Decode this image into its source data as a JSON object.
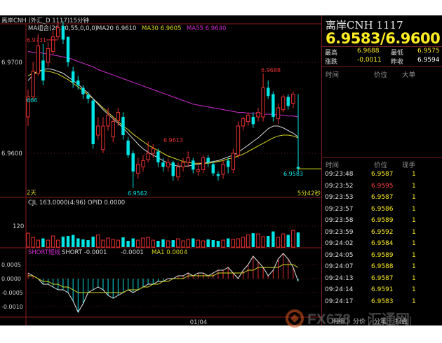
{
  "colors": {
    "up": "#00e5e5",
    "down": "#e83030",
    "ma20": "#d8d8d8",
    "ma30": "#d9d920",
    "ma55": "#d02cd0",
    "price_yellow": "#ffee22"
  },
  "chart": {
    "header": "离岸CNH (外汇_D 1117)15分钟",
    "ma_label": "MA组合(20,30,55,0,0,0)",
    "ma20": "MA20 6.9610",
    "ma30": "MA30 6.9605",
    "ma55": "MA55 6.9640",
    "y_labels": [
      "6.9700",
      "6.9600"
    ],
    "annotations": {
      "high_left": "6.9731",
      "left_666": "666",
      "a_6_9688": "6.9688",
      "a_6_9613": "6.9613",
      "a_6_9562": "6.9562",
      "a_6_9583": "6.9583"
    },
    "days_label": "2天",
    "remaining_label": "5分42秒",
    "cjl": "CJL  163.0000(4:96)    OPID   0.0000",
    "vol_y": "120",
    "short_title": "SHORT短线",
    "short_v": "SHORT   -0.0001",
    "short_v2": "-0.0001",
    "short_ma": "MA1   0.0004",
    "macd_y": [
      "0.0005",
      "0.0000",
      "-0.0005",
      "-0.0010"
    ],
    "x_label": "01/04"
  },
  "chart_data": {
    "type": "candlestick",
    "opens": [
      6.964,
      6.9662,
      6.9688,
      6.9702,
      6.97,
      6.9712,
      6.9728,
      6.974,
      6.9728,
      6.969,
      6.968,
      6.9672,
      6.9664,
      6.9658,
      6.962,
      6.9604,
      6.963,
      6.9618,
      6.9636,
      6.964,
      6.9614,
      6.96,
      6.9578,
      6.9585,
      6.9593,
      6.96,
      6.9602,
      6.959,
      6.9585,
      6.959,
      6.9574,
      6.9585,
      6.959,
      6.9592,
      6.958,
      6.9582,
      6.9595,
      6.9588,
      6.9577,
      6.9577,
      6.9592,
      6.9582,
      6.9598,
      6.963,
      6.9635,
      6.964,
      6.964,
      6.964,
      6.9672,
      6.9665,
      6.9638,
      6.9648,
      6.9662,
      6.9655,
      6.9585
    ],
    "closes": [
      6.9662,
      6.969,
      6.9718,
      6.968,
      6.9715,
      6.9728,
      6.9738,
      6.9725,
      6.97,
      6.9678,
      6.9675,
      6.9665,
      6.966,
      6.961,
      6.963,
      6.963,
      6.9642,
      6.9635,
      6.9645,
      6.962,
      6.9598,
      6.958,
      6.9588,
      6.9592,
      6.96,
      6.9605,
      6.959,
      6.9585,
      6.959,
      6.9575,
      6.9585,
      6.959,
      6.9595,
      6.9582,
      6.9582,
      6.9595,
      6.959,
      6.9578,
      6.9575,
      6.9588,
      6.9585,
      6.96,
      6.963,
      6.9638,
      6.9642,
      6.9632,
      6.9645,
      6.9672,
      6.9663,
      6.964,
      6.965,
      6.9662,
      6.9652,
      6.9665,
      6.9583
    ],
    "highs": [
      6.967,
      6.97,
      6.9731,
      6.972,
      6.9722,
      6.9735,
      6.9745,
      6.9745,
      6.9728,
      6.9695,
      6.9685,
      6.9675,
      6.9668,
      6.966,
      6.964,
      6.964,
      6.965,
      6.964,
      6.965,
      6.9645,
      6.9618,
      6.9603,
      6.9595,
      6.9598,
      6.9613,
      6.961,
      6.9605,
      6.9595,
      6.9595,
      6.9592,
      6.959,
      6.9595,
      6.9602,
      6.9595,
      6.959,
      6.9598,
      6.9598,
      6.9592,
      6.958,
      6.9592,
      6.9595,
      6.9605,
      6.9635,
      6.964,
      6.9645,
      6.9645,
      6.965,
      6.9688,
      6.968,
      6.9668,
      6.9655,
      6.9665,
      6.9665,
      6.9668,
      6.9665
    ],
    "lows": [
      6.963,
      6.9658,
      6.9685,
      6.9675,
      6.9695,
      6.9708,
      6.9725,
      6.972,
      6.9695,
      6.9672,
      6.967,
      6.966,
      6.9655,
      6.9605,
      6.9615,
      6.96,
      6.9625,
      6.9612,
      6.963,
      6.9615,
      6.9595,
      6.9562,
      6.9572,
      6.958,
      6.959,
      6.9595,
      6.9585,
      6.958,
      6.958,
      6.957,
      6.957,
      6.958,
      6.9585,
      6.9578,
      6.9575,
      6.9578,
      6.9585,
      6.9575,
      6.957,
      6.9572,
      6.9578,
      6.9578,
      6.9595,
      6.9625,
      6.963,
      6.9628,
      6.9635,
      6.9635,
      6.966,
      6.9635,
      6.9632,
      6.9645,
      6.9648,
      6.965,
      6.958
    ],
    "volumes": [
      40,
      28,
      20,
      25,
      20,
      32,
      20,
      30,
      32,
      35,
      25,
      22,
      20,
      30,
      35,
      20,
      26,
      22,
      20,
      28,
      18,
      25,
      20,
      26,
      28,
      20,
      18,
      22,
      18,
      20,
      24,
      18,
      22,
      25,
      20,
      18,
      22,
      20,
      18,
      20,
      25,
      22,
      24,
      28,
      35,
      40,
      38,
      30,
      32,
      45,
      28,
      38,
      35,
      48,
      42
    ],
    "vol_max": 160,
    "ma20": [
      6.968,
      6.9686,
      6.969,
      6.9692,
      6.9693,
      6.9692,
      6.969,
      6.9688,
      6.9684,
      6.968,
      6.9676,
      6.9671,
      6.9666,
      6.966,
      6.9654,
      6.9648,
      6.9643,
      6.9638,
      6.9633,
      6.9628,
      6.9622,
      6.9616,
      6.961,
      6.9605,
      6.9601,
      6.9598,
      6.9595,
      6.9592,
      6.9589,
      6.9587,
      6.9586,
      6.9586,
      6.9586,
      6.9587,
      6.9588,
      6.9589,
      6.959,
      6.9591,
      6.9592,
      6.9594,
      6.9596,
      6.9598,
      6.9601,
      6.9605,
      6.9609,
      6.9613,
      6.9617,
      6.9622,
      6.9627,
      6.963,
      6.963,
      6.9628,
      6.9625,
      6.9622,
      6.9618
    ],
    "ma30": [
      6.9685,
      6.9688,
      6.969,
      6.9691,
      6.969,
      6.9689,
      6.9687,
      6.9684,
      6.9681,
      6.9677,
      6.9673,
      6.9669,
      6.9664,
      6.966,
      6.9655,
      6.965,
      6.9645,
      6.964,
      6.9635,
      6.963,
      6.9626,
      6.9621,
      6.9617,
      6.9613,
      6.9609,
      6.9606,
      6.9603,
      6.96,
      6.9597,
      6.9595,
      6.9593,
      6.9591,
      6.959,
      6.9589,
      6.9589,
      6.9589,
      6.9589,
      6.959,
      6.9591,
      6.9592,
      6.9594,
      6.9595,
      6.9597,
      6.9599,
      6.9602,
      6.9605,
      6.9608,
      6.9611,
      6.9614,
      6.9617,
      6.9619,
      6.962,
      6.962,
      6.9619,
      6.9617
    ],
    "ma55": [
      6.9712,
      6.9711,
      6.9711,
      6.971,
      6.9709,
      6.9708,
      6.9707,
      6.9706,
      6.9705,
      6.9703,
      6.9701,
      6.9699,
      6.9697,
      6.9695,
      6.9692,
      6.969,
      6.9688,
      6.9686,
      6.9684,
      6.9682,
      6.968,
      6.9678,
      6.9676,
      6.9674,
      6.9672,
      6.967,
      6.9668,
      6.9666,
      6.9664,
      6.9662,
      6.966,
      6.9658,
      6.9656,
      6.9654,
      6.9653,
      6.9652,
      6.9651,
      6.965,
      6.9649,
      6.9648,
      6.9647,
      6.9646,
      6.9645,
      6.9645,
      6.9644,
      6.9644,
      6.9644,
      6.9643,
      6.9643,
      6.9643,
      6.9642,
      6.9642,
      6.9641,
      6.9641,
      6.964
    ],
    "short": [
      0.0002,
      0.0001,
      0.0,
      -0.0002,
      -0.0002,
      -0.0003,
      -0.0004,
      -0.0004,
      -0.0005,
      -0.0008,
      -0.0012,
      -0.0009,
      -0.0005,
      -0.0004,
      -0.0003,
      -0.0004,
      -0.0006,
      -0.0007,
      -0.0006,
      -0.0005,
      -0.0004,
      -0.0005,
      -0.0004,
      -0.0003,
      -0.0002,
      -0.0002,
      -0.0001,
      -0.0001,
      0.0,
      0.0,
      0.0001,
      0.0001,
      0.0002,
      0.0001,
      0.0002,
      0.0002,
      0.0001,
      0.0002,
      0.0003,
      0.0003,
      0.0004,
      0.0002,
      0.0,
      0.0003,
      0.0005,
      0.0008,
      0.0006,
      0.0004,
      0.0001,
      0.0003,
      0.0007,
      0.0009,
      0.0007,
      0.0004,
      -0.0001
    ],
    "short_ma": [
      0.0001,
      0.0001,
      0.0,
      -0.0001,
      -0.0001,
      -0.0002,
      -0.0002,
      -0.0003,
      -0.0003,
      -0.0004,
      -0.0005,
      -0.0005,
      -0.0005,
      -0.0005,
      -0.0005,
      -0.0005,
      -0.0005,
      -0.0005,
      -0.0005,
      -0.0005,
      -0.0004,
      -0.0004,
      -0.0004,
      -0.0003,
      -0.0003,
      -0.0002,
      -0.0002,
      -0.0001,
      -0.0001,
      0.0,
      0.0,
      0.0,
      0.0001,
      0.0001,
      0.0001,
      0.0001,
      0.0001,
      0.0001,
      0.0002,
      0.0002,
      0.0002,
      0.0002,
      0.0002,
      0.0002,
      0.0003,
      0.0003,
      0.0004,
      0.0004,
      0.0004,
      0.0004,
      0.0004,
      0.0005,
      0.0005,
      0.0005,
      0.0004
    ]
  },
  "quote": {
    "title": "离岸CNH    1117",
    "price": "6.9583/6.9600",
    "stats": [
      {
        "l1": "最高",
        "v1": "6.9688",
        "c1": "#ffee22",
        "l2": "最低",
        "v2": "6.9575",
        "c2": "#ffee22"
      },
      {
        "l1": "涨跌",
        "v1": "-0.0011",
        "c1": "#ffee22",
        "l2": "昨收",
        "v2": "6.9594",
        "c2": "#ffffff"
      }
    ],
    "hdr1": {
      "a": "时间",
      "b": "价位",
      "c": "大单"
    },
    "hdr2": {
      "a": "时间",
      "b": "价位",
      "c": "现手"
    },
    "trades": [
      {
        "t": "09:23:48",
        "p": "6.9587",
        "q": "1",
        "c": "#ffee22"
      },
      {
        "t": "09:23:52",
        "p": "6.9595",
        "q": "1",
        "c": "#ff4040"
      },
      {
        "t": "09:23:53",
        "p": "6.9587",
        "q": "1",
        "c": "#ffee22"
      },
      {
        "t": "09:23:57",
        "p": "6.9586",
        "q": "1",
        "c": "#ffee22"
      },
      {
        "t": "09:23:58",
        "p": "6.9589",
        "q": "1",
        "c": "#ffee22"
      },
      {
        "t": "09:23:59",
        "p": "6.9592",
        "q": "1",
        "c": "#ffee22"
      },
      {
        "t": "09:24:02",
        "p": "6.9584",
        "q": "1",
        "c": "#ffee22"
      },
      {
        "t": "09:24:05",
        "p": "6.9589",
        "q": "1",
        "c": "#ffee22"
      },
      {
        "t": "09:24:07",
        "p": "6.9588",
        "q": "1",
        "c": "#ffee22"
      },
      {
        "t": "09:24:13",
        "p": "6.9587",
        "q": "1",
        "c": "#ffee22"
      },
      {
        "t": "09:24:14",
        "p": "6.9591",
        "q": "1",
        "c": "#ffee22"
      },
      {
        "t": "09:24:17",
        "p": "6.9583",
        "q": "1",
        "c": "#ffee22"
      }
    ],
    "tabs": [
      "明细",
      "分价",
      "分笔",
      "扫盘"
    ]
  },
  "watermark": {
    "text1": "FX678",
    "text2": "汇通网"
  }
}
